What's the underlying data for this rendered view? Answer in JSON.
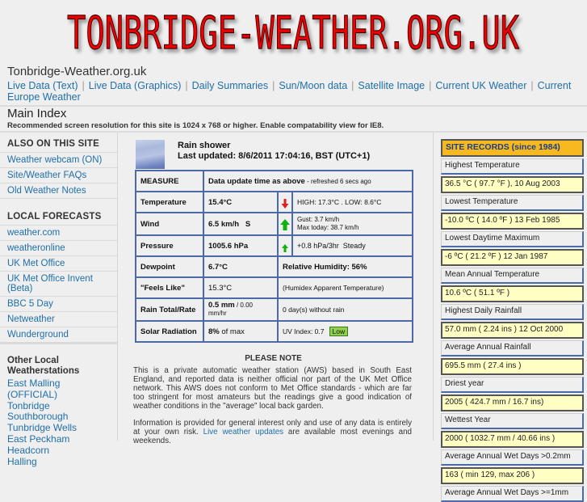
{
  "banner": {
    "text": "TONBRIDGE-WEATHER.ORG.UK"
  },
  "header": {
    "site_title": "Tonbridge-Weather.org.uk",
    "nav": [
      "Live Data (Text)",
      "Live Data (Graphics)",
      "Daily Summaries",
      "Sun/Moon data",
      "Satellite Image",
      "Current UK Weather",
      "Current Europe Weather"
    ],
    "page_title": "Main Index",
    "resolution_note": "Recommended screen resolution for this site is 1024 x 768 or higher. Enable compatability view for IE8."
  },
  "sidebar": {
    "also_heading": "ALSO ON THIS SITE",
    "also_items": [
      "Weather webcam (ON)",
      "Site/Weather FAQs",
      "Old Weather Notes"
    ],
    "forecasts_heading": "LOCAL FORECASTS",
    "forecast_items": [
      "weather.com",
      "weatheronline",
      "UK Met Office",
      "UK Met Office Invent (Beta)",
      "BBC 5 Day",
      "Netweather",
      "Wunderground"
    ],
    "stations_heading": "Other Local Weatherstations",
    "stations": [
      "East Malling (OFFICIAL)",
      "Tonbridge",
      "Southborough",
      "Tunbridge Wells",
      "East Peckham",
      "Headcorn",
      "Halling"
    ]
  },
  "conditions": {
    "summary": "Rain shower",
    "last_updated": "Last updated: 8/6/2011 17:04:16, BST (UTC+1)",
    "icon": "rain-shower-sky-icon"
  },
  "table": {
    "header_measure": "MEASURE",
    "header_update": "Data update time as above",
    "header_refreshed": " - refreshed 6 secs ago",
    "temperature": {
      "label": "Temperature",
      "value": "15.4°C",
      "trend": "down",
      "note": "HIGH: 17.3°C . LOW: 8.6°C",
      "trend_color": "#e02020"
    },
    "wind": {
      "label": "Wind",
      "value": "6.5 km/h   S",
      "trend": "up",
      "gust": "Gust: 3.7 km/h",
      "max_today": "Max today: 38.7 km/h",
      "trend_color": "#10b010"
    },
    "pressure": {
      "label": "Pressure",
      "value": "1005.6 hPa",
      "trend": "up",
      "note": "+0.8 hPa/3hr  Steady",
      "trend_color": "#10b010"
    },
    "dewpoint": {
      "label": "Dewpoint",
      "value": "6.7°C",
      "note": "Relative Humidity: 56%"
    },
    "feels_like": {
      "label": "\"Feels Like\"",
      "value": "15.3°C",
      "note": "(Humidex Apparent Temperature)"
    },
    "rain": {
      "label": "Rain Total/Rate",
      "total": "0.5 mm",
      "rate": " / 0.00",
      "rate_unit": "mm/hr",
      "note": "0 day(s) without rain"
    },
    "solar": {
      "label": "Solar Radiation",
      "percent": "8%",
      "suffix": " of max",
      "uv": "UV Index: 0.7",
      "uv_level": "Low"
    }
  },
  "notes": {
    "title": "PLEASE NOTE",
    "p1": "This is a private automatic weather station (AWS) based in South East England, and reported data is neither official nor part of the UK Met Office network. This AWS does not conform to Met Office standards - which are far too stringent for most amateurs but the readings give a good indication of weather conditions in the \"average\" local back garden.",
    "p2_start": "Information is provided for general interest only and use of any data is entirely at your own risk. ",
    "p2_link": "Live weather updates",
    "p2_end": " are available most evenings and weekends."
  },
  "records": {
    "title": "SITE RECORDS (since 1984)",
    "items": [
      {
        "label": "Highest Temperature",
        "value": "36.5 °C ( 97.7 °F ), 10 Aug 2003"
      },
      {
        "label": "Lowest Temperature",
        "value": "-10.0 ºC ( 14.0 ºF ) 13 Feb 1985"
      },
      {
        "label": "Lowest Daytime Maximum",
        "value": "-6 ºC ( 21.2 ºF ) 12 Jan 1987"
      },
      {
        "label": "Mean Annual Temperature",
        "value": "10.6 ºC ( 51.1 ºF )"
      },
      {
        "label": "Highest Daily Rainfall",
        "value": "57.0 mm ( 2.24 ins ) 12 Oct 2000"
      },
      {
        "label": "Average Annual Rainfall",
        "value": "695.5 mm ( 27.4 ins )"
      },
      {
        "label": "Driest year",
        "value": "2005 ( 424.7 mm / 16.7 ins)"
      },
      {
        "label": "Wettest Year",
        "value": "2000 ( 1032.7 mm / 40.66 ins )"
      },
      {
        "label": "Average Annual Wet Days >0.2mm",
        "value": "163 ( min 129, max 206 )"
      },
      {
        "label": "Average Annual Wet Days >=1mm",
        "value": ""
      }
    ]
  }
}
